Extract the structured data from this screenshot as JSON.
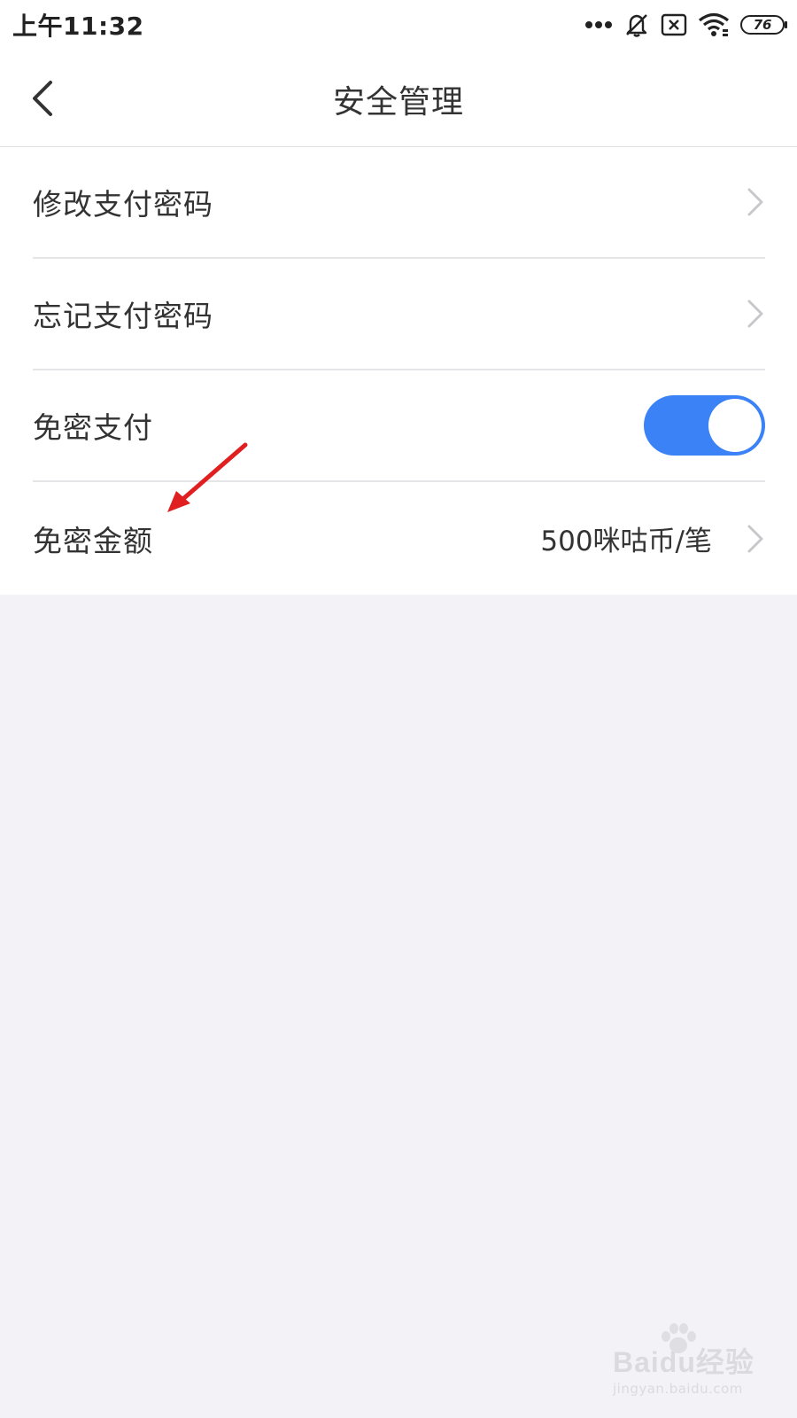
{
  "status_bar": {
    "time": "上午11:32",
    "battery": "76",
    "icons": [
      "more-dots-icon",
      "bell-off-icon",
      "sim-off-icon",
      "wifi-icon",
      "battery-icon"
    ]
  },
  "nav": {
    "title": "安全管理",
    "back_icon": "chevron-left-icon"
  },
  "settings": {
    "items": [
      {
        "label": "修改支付密码",
        "type": "link"
      },
      {
        "label": "忘记支付密码",
        "type": "link"
      },
      {
        "label": "免密支付",
        "type": "toggle",
        "enabled": true
      },
      {
        "label": "免密金额",
        "type": "link",
        "value": "500咪咕币/笔"
      }
    ]
  },
  "colors": {
    "accent": "#3b82f6",
    "background": "#f2f2f7",
    "annotation": "#e02020"
  },
  "watermark": {
    "brand": "Baidu经验",
    "url": "jingyan.baidu.com"
  }
}
